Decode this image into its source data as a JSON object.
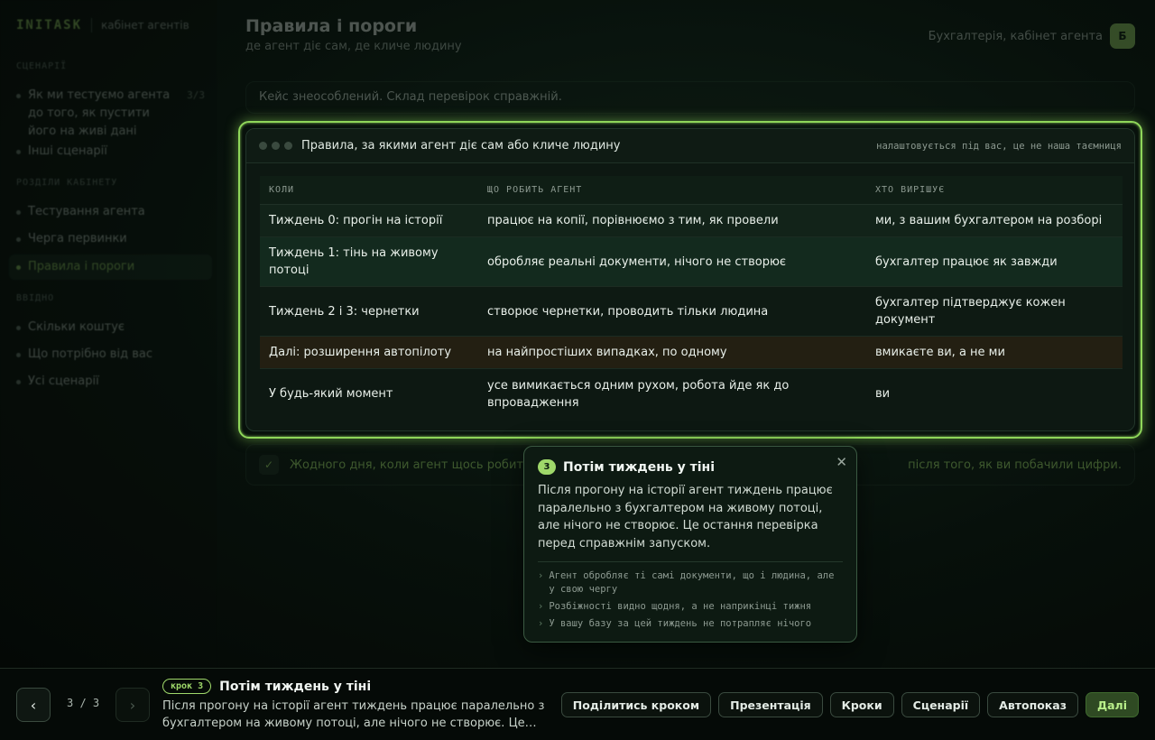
{
  "brand": {
    "name": "INITASK",
    "subtitle": "кабінет агентів"
  },
  "sidebar": {
    "sections": [
      {
        "label": "СЦЕНАРІЇ",
        "items": [
          {
            "label": "Як ми тестуємо агента до того, як пустити його на живі дані",
            "count": "3/3"
          },
          {
            "label": "Інші сценарії"
          }
        ]
      },
      {
        "label": "РОЗДІЛИ КАБІНЕТУ",
        "items": [
          {
            "label": "Тестування агента"
          },
          {
            "label": "Черга первинки"
          },
          {
            "label": "Правила і пороги"
          }
        ]
      },
      {
        "label": "ВВІДНО",
        "items": [
          {
            "label": "Скільки коштує"
          },
          {
            "label": "Що потрібно від вас"
          },
          {
            "label": "Усі сценарії"
          }
        ]
      }
    ]
  },
  "header": {
    "title": "Правила і пороги",
    "subtitle": "де агент діє сам, де кличе людину",
    "org": "Бухгалтерія, кабінет агента",
    "avatar": "Б"
  },
  "notice": "Кейс знеособлений. Склад перевірок справжній.",
  "card": {
    "title": "Правила, за якими агент діє сам або кличе людину",
    "meta": "налаштовується під вас, це не наша таємниця",
    "columns": [
      "КОЛИ",
      "ЩО РОБИТЬ АГЕНТ",
      "ХТО ВИРІШУЄ"
    ],
    "rows": [
      [
        "Тиждень 0: прогін на історії",
        "працює на копії, порівнюємо з тим, як провели",
        "ми, з вашим бухгалтером на розборі"
      ],
      [
        "Тиждень 1: тінь на живому потоці",
        "обробляє реальні документи, нічого не створює",
        "бухгалтер працює як завжди"
      ],
      [
        "Тиждень 2 і 3: чернетки",
        "створює чернетки, проводить тільки людина",
        "бухгалтер підтверджує кожен документ"
      ],
      [
        "Далі: розширення автопілоту",
        "на найпростіших випадках, по одному",
        "вмикаєте ви, а не ми"
      ],
      [
        "У будь-який момент",
        "усе вимикається одним рухом, робота йде як до впровадження",
        "ви"
      ]
    ]
  },
  "bottom_note": {
    "check": "✓",
    "left": "Жодного дня, коли агент щось робить",
    "right": "після того, як ви побачили цифри."
  },
  "tooltip": {
    "step": "3",
    "title": "Потім тиждень у тіні",
    "close": "✕",
    "body": "Після прогону на історії агент тиждень працює паралельно з бухгалтером на живому потоці, але нічого не створює. Це остання перевірка перед справжнім запуском.",
    "bullets": [
      "Агент обробляє ті самі документи, що і людина, але у свою чергу",
      "Розбіжності видно щодня, а не наприкінці тижня",
      "У вашу базу за цей тиждень не потрапляє нічого"
    ]
  },
  "bottom_bar": {
    "prev": "‹",
    "next": "›",
    "counter": "3 / 3",
    "step_badge": "крок 3",
    "step_title": "Потім тиждень у тіні",
    "step_desc": "Після прогону на історії агент тиждень працює паралельно з бухгалтером на живому потоці, але нічого не створює. Це остання перевірка перед справжнім запуском.",
    "actions": [
      "Поділитись кроком",
      "Презентація",
      "Кроки",
      "Сценарії",
      "Автопоказ",
      "Далі"
    ]
  },
  "colors": {
    "accent": "#9fd86a",
    "highlight": "#8fd65a",
    "background": "#050a07"
  }
}
